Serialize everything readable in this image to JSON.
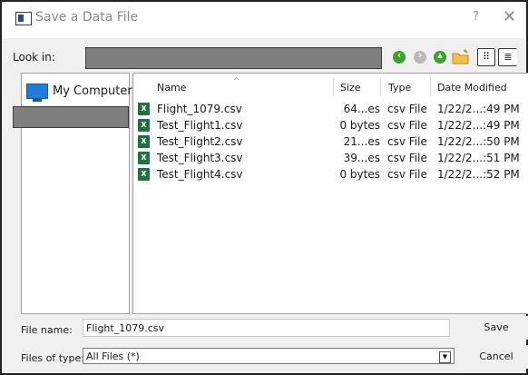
{
  "window": {
    "title": "Save a Data File",
    "help_glyph": "?",
    "close_glyph": "✕"
  },
  "lookin": {
    "label": "Look in:",
    "value": ""
  },
  "toolbar": {
    "back_icon": "back-arrow-icon",
    "forward_icon": "forward-arrow-icon",
    "up_icon": "up-arrow-icon",
    "new_folder_icon": "new-folder-icon",
    "list_view_icon": "list-view-icon",
    "detail_view_icon": "detail-view-icon"
  },
  "sidebar": {
    "items": [
      {
        "label": "My Computer",
        "icon": "computer-icon"
      }
    ]
  },
  "filelist": {
    "columns": {
      "name": "Name",
      "size": "Size",
      "type": "Type",
      "date": "Date Modified"
    },
    "rows": [
      {
        "name": "Flight_1079.csv",
        "size": "64...es",
        "type": "csv File",
        "date": "1/22/2...:49 PM"
      },
      {
        "name": "Test_Flight1.csv",
        "size": "0 bytes",
        "type": "csv File",
        "date": "1/22/2...:49 PM"
      },
      {
        "name": "Test_Flight2.csv",
        "size": "21...es",
        "type": "csv File",
        "date": "1/22/2...:50 PM"
      },
      {
        "name": "Test_Flight3.csv",
        "size": "39...es",
        "type": "csv File",
        "date": "1/22/2...:51 PM"
      },
      {
        "name": "Test_Flight4.csv",
        "size": "0 bytes",
        "type": "csv File",
        "date": "1/22/2...:52 PM"
      }
    ]
  },
  "footer": {
    "filename_label": "File name:",
    "filename_value": "Flight_1079.csv",
    "save_label": "Save",
    "filetype_label": "Files of type:",
    "filetype_value": "All Files (*)",
    "cancel_label": "Cancel"
  },
  "colors": {
    "accent_green": "#3aa32b",
    "excel_green": "#1e7145",
    "redaction": "#7f7f7f"
  }
}
